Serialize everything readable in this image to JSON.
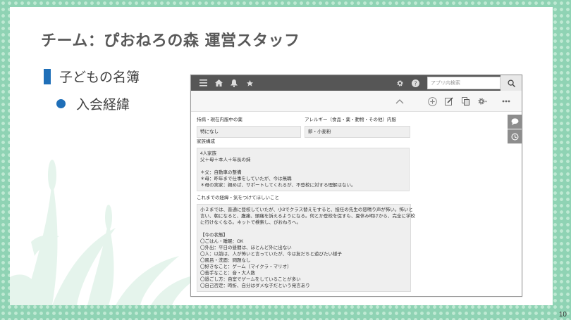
{
  "slide": {
    "title": "チーム：ぴおねろの森 運営スタッフ",
    "bullet1": "子どもの名簿",
    "bullet2": "入会経緯",
    "page_number": "10"
  },
  "colors": {
    "accent_blue": "#1f6fb8",
    "frame_green": "#8fd3b4",
    "app_header": "#565656"
  },
  "app": {
    "header_icons": [
      "menu-icon",
      "home-icon",
      "bell-icon",
      "star-icon"
    ],
    "header_right_icons": [
      "gear-icon",
      "help-icon"
    ],
    "search_placeholder": "アプリ内検索",
    "toolbar_icons": [
      "chevron-up-icon",
      "plus-icon",
      "edit-icon",
      "copy-icon",
      "gear-icon",
      "more-icon"
    ],
    "side_icons": [
      "comment-icon",
      "history-icon"
    ],
    "fields": {
      "illness": {
        "label": "持病・現在内服中の薬",
        "value": "特になし"
      },
      "allergy": {
        "label": "アレルギー（食品・薬・動物・その他）内服",
        "value": "卵・小麦粉"
      },
      "family": {
        "label": "家族構成",
        "lines": [
          "4人家族",
          "父＋母＋本人＋年長の妹",
          "",
          "＊父：自動車の整備",
          "＊母：昨年まで仕事をしていたが、今は無職",
          "＊母の実家：親めば、サポートしてくれるが、不登校に対する理解はない。"
        ]
      },
      "history": {
        "label": "これまでの経緯・気をつけてほしいこと",
        "lines": [
          "小２までは、普通に登校していたが、小3でクラス替えをすると、担任の先生の怒鳴り声が怖い。怖いと",
          "言い、朝になると、腹痛、頭痛を訴えるようになる。何とか登校を促すも、夏休み明けから、完全に学校",
          "に行けなくなる。ネットで検索し、ぴおねろへ。",
          "",
          "【今の状態】",
          "〇ごはん・睡眠：OK",
          "〇外出：平日の昼間は、ほとんど外に出ない",
          "〇人：以前は、人が怖いと言っていたが、今は友だちと遊びたい様子",
          "〇風呂・洗面：問題なし",
          "〇好きなこと：ゲーム（マイクラ・マリオ）",
          "〇苦手なこと：音・大人数",
          "〇過ごし方：自室でゲームをしていることが多い",
          "〇自己否定：時折、自分はダメな子だという発言あり"
        ]
      }
    }
  }
}
